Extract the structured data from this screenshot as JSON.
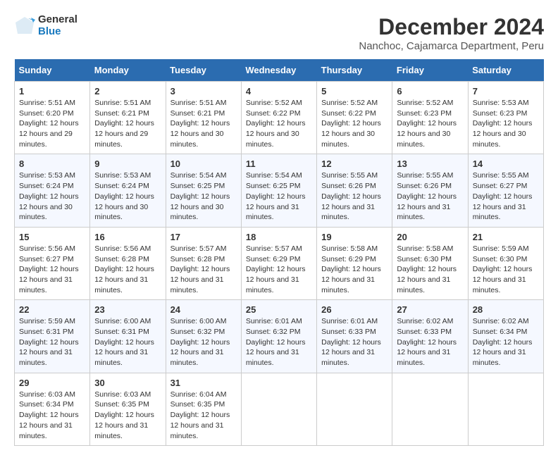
{
  "logo": {
    "line1": "General",
    "line2": "Blue"
  },
  "title": "December 2024",
  "subtitle": "Nanchoc, Cajamarca Department, Peru",
  "weekdays": [
    "Sunday",
    "Monday",
    "Tuesday",
    "Wednesday",
    "Thursday",
    "Friday",
    "Saturday"
  ],
  "weeks": [
    [
      {
        "day": "1",
        "sunrise": "5:51 AM",
        "sunset": "6:20 PM",
        "daylight": "12 hours and 29 minutes."
      },
      {
        "day": "2",
        "sunrise": "5:51 AM",
        "sunset": "6:21 PM",
        "daylight": "12 hours and 29 minutes."
      },
      {
        "day": "3",
        "sunrise": "5:51 AM",
        "sunset": "6:21 PM",
        "daylight": "12 hours and 30 minutes."
      },
      {
        "day": "4",
        "sunrise": "5:52 AM",
        "sunset": "6:22 PM",
        "daylight": "12 hours and 30 minutes."
      },
      {
        "day": "5",
        "sunrise": "5:52 AM",
        "sunset": "6:22 PM",
        "daylight": "12 hours and 30 minutes."
      },
      {
        "day": "6",
        "sunrise": "5:52 AM",
        "sunset": "6:23 PM",
        "daylight": "12 hours and 30 minutes."
      },
      {
        "day": "7",
        "sunrise": "5:53 AM",
        "sunset": "6:23 PM",
        "daylight": "12 hours and 30 minutes."
      }
    ],
    [
      {
        "day": "8",
        "sunrise": "5:53 AM",
        "sunset": "6:24 PM",
        "daylight": "12 hours and 30 minutes."
      },
      {
        "day": "9",
        "sunrise": "5:53 AM",
        "sunset": "6:24 PM",
        "daylight": "12 hours and 30 minutes."
      },
      {
        "day": "10",
        "sunrise": "5:54 AM",
        "sunset": "6:25 PM",
        "daylight": "12 hours and 30 minutes."
      },
      {
        "day": "11",
        "sunrise": "5:54 AM",
        "sunset": "6:25 PM",
        "daylight": "12 hours and 31 minutes."
      },
      {
        "day": "12",
        "sunrise": "5:55 AM",
        "sunset": "6:26 PM",
        "daylight": "12 hours and 31 minutes."
      },
      {
        "day": "13",
        "sunrise": "5:55 AM",
        "sunset": "6:26 PM",
        "daylight": "12 hours and 31 minutes."
      },
      {
        "day": "14",
        "sunrise": "5:55 AM",
        "sunset": "6:27 PM",
        "daylight": "12 hours and 31 minutes."
      }
    ],
    [
      {
        "day": "15",
        "sunrise": "5:56 AM",
        "sunset": "6:27 PM",
        "daylight": "12 hours and 31 minutes."
      },
      {
        "day": "16",
        "sunrise": "5:56 AM",
        "sunset": "6:28 PM",
        "daylight": "12 hours and 31 minutes."
      },
      {
        "day": "17",
        "sunrise": "5:57 AM",
        "sunset": "6:28 PM",
        "daylight": "12 hours and 31 minutes."
      },
      {
        "day": "18",
        "sunrise": "5:57 AM",
        "sunset": "6:29 PM",
        "daylight": "12 hours and 31 minutes."
      },
      {
        "day": "19",
        "sunrise": "5:58 AM",
        "sunset": "6:29 PM",
        "daylight": "12 hours and 31 minutes."
      },
      {
        "day": "20",
        "sunrise": "5:58 AM",
        "sunset": "6:30 PM",
        "daylight": "12 hours and 31 minutes."
      },
      {
        "day": "21",
        "sunrise": "5:59 AM",
        "sunset": "6:30 PM",
        "daylight": "12 hours and 31 minutes."
      }
    ],
    [
      {
        "day": "22",
        "sunrise": "5:59 AM",
        "sunset": "6:31 PM",
        "daylight": "12 hours and 31 minutes."
      },
      {
        "day": "23",
        "sunrise": "6:00 AM",
        "sunset": "6:31 PM",
        "daylight": "12 hours and 31 minutes."
      },
      {
        "day": "24",
        "sunrise": "6:00 AM",
        "sunset": "6:32 PM",
        "daylight": "12 hours and 31 minutes."
      },
      {
        "day": "25",
        "sunrise": "6:01 AM",
        "sunset": "6:32 PM",
        "daylight": "12 hours and 31 minutes."
      },
      {
        "day": "26",
        "sunrise": "6:01 AM",
        "sunset": "6:33 PM",
        "daylight": "12 hours and 31 minutes."
      },
      {
        "day": "27",
        "sunrise": "6:02 AM",
        "sunset": "6:33 PM",
        "daylight": "12 hours and 31 minutes."
      },
      {
        "day": "28",
        "sunrise": "6:02 AM",
        "sunset": "6:34 PM",
        "daylight": "12 hours and 31 minutes."
      }
    ],
    [
      {
        "day": "29",
        "sunrise": "6:03 AM",
        "sunset": "6:34 PM",
        "daylight": "12 hours and 31 minutes."
      },
      {
        "day": "30",
        "sunrise": "6:03 AM",
        "sunset": "6:35 PM",
        "daylight": "12 hours and 31 minutes."
      },
      {
        "day": "31",
        "sunrise": "6:04 AM",
        "sunset": "6:35 PM",
        "daylight": "12 hours and 31 minutes."
      },
      null,
      null,
      null,
      null
    ]
  ],
  "labels": {
    "sunrise": "Sunrise: ",
    "sunset": "Sunset: ",
    "daylight": "Daylight: 12 hours"
  }
}
